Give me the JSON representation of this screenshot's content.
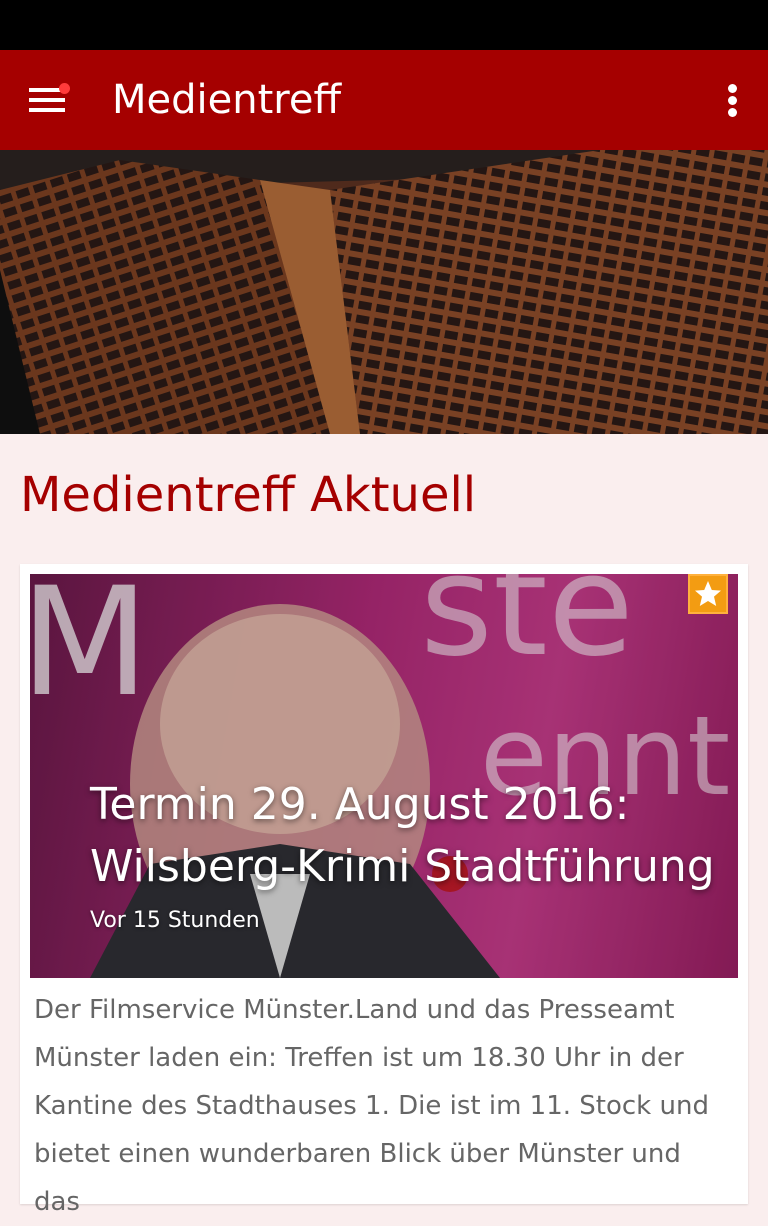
{
  "app_bar": {
    "title": "Medientreff",
    "menu_icon": "hamburger-menu-icon",
    "notification_dot_color": "#ff3b3b",
    "overflow_icon": "more-vertical-icon",
    "background_color": "#a50000"
  },
  "hero": {
    "image": "theater-auditorium-seats"
  },
  "section": {
    "title": "Medientreff Aktuell"
  },
  "article": {
    "title": "Termin 29. August 2016: Wilsberg-Krimi Stadtführung",
    "time": "Vor 15 Stunden",
    "body": "Der Filmservice Münster.Land und das Presseamt Münster laden ein: Treffen ist um 18.30 Uhr in der Kantine des Stadthauses 1. Die ist im 11. Stock und bietet einen wunderbaren Blick über Münster und das",
    "favorite_icon": "star-icon",
    "favorite_color": "#f39c12"
  }
}
